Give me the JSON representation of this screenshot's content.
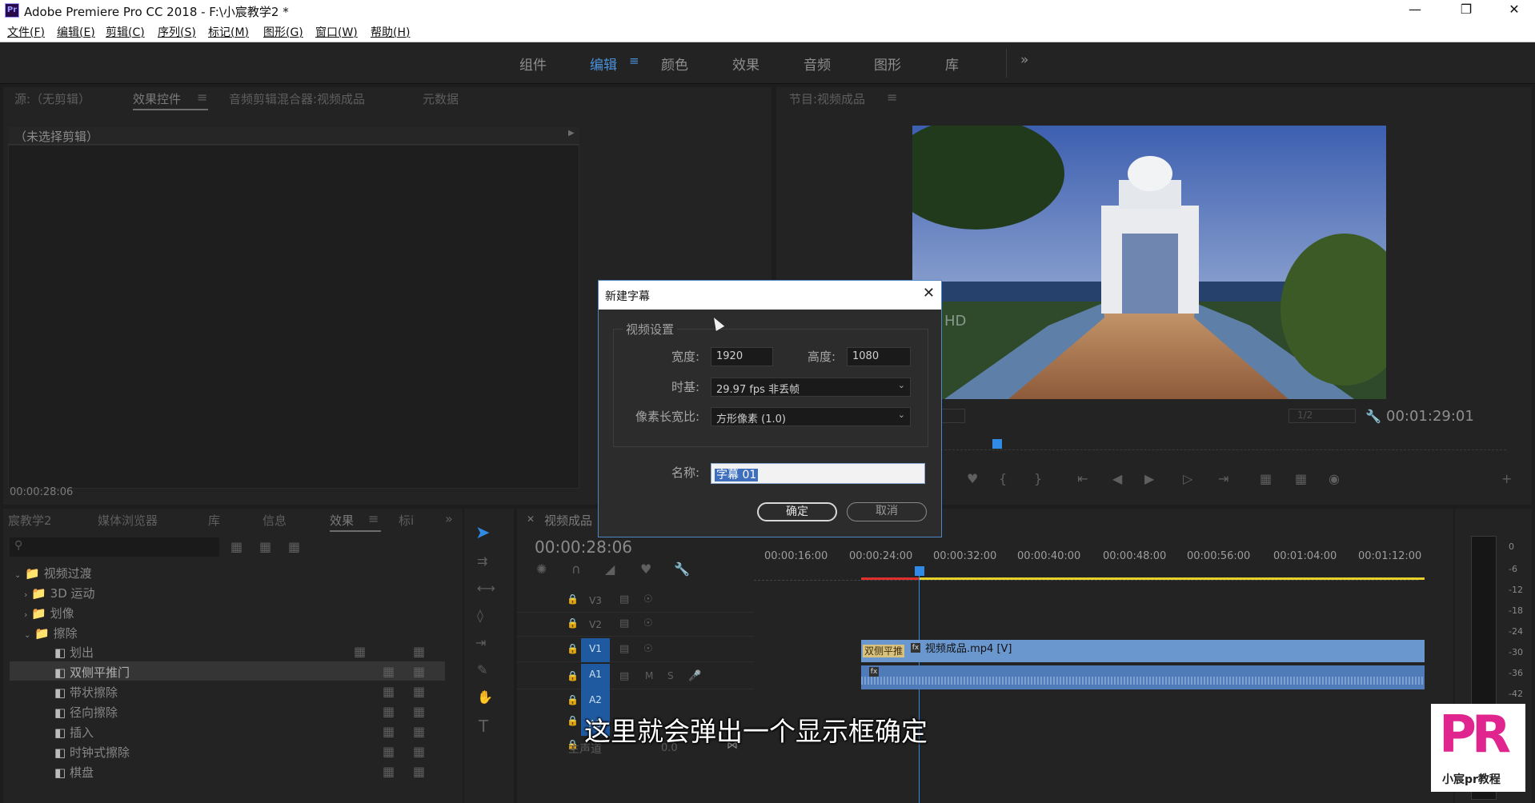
{
  "window": {
    "title": "Adobe Premiere Pro CC 2018 - F:\\小宸教学2 *",
    "logo": "Pr",
    "minimize_icon": "minimize-icon",
    "restore_icon": "restore-icon",
    "close_icon": "close-icon"
  },
  "menu": [
    "文件(F)",
    "编辑(E)",
    "剪辑(C)",
    "序列(S)",
    "标记(M)",
    "图形(G)",
    "窗口(W)",
    "帮助(H)"
  ],
  "workspaces": [
    "组件",
    "编辑",
    "颜色",
    "效果",
    "音频",
    "图形",
    "库"
  ],
  "workspace_active": "编辑",
  "source_panel": {
    "tabs": [
      "源:（无剪辑）",
      "效果控件",
      "音频剪辑混合器:视频成品",
      "元数据"
    ],
    "active_tab": "效果控件",
    "no_clip_label": "（未选择剪辑）",
    "timecode": "00:00:28:06"
  },
  "program_panel": {
    "tab": "节目:视频成品",
    "timecode": "00:01:29:01",
    "resolution": "1/2",
    "watermark": "HD"
  },
  "project_panel": {
    "tabs": [
      "宸教学2",
      "媒体浏览器",
      "库",
      "信息",
      "效果",
      "标i"
    ],
    "active_tab": "效果",
    "tree": [
      {
        "label": "视频过渡",
        "level": 0,
        "expanded": true
      },
      {
        "label": "3D 运动",
        "level": 1,
        "expanded": false
      },
      {
        "label": "划像",
        "level": 1,
        "expanded": false
      },
      {
        "label": "擦除",
        "level": 1,
        "expanded": true
      },
      {
        "label": "划出",
        "level": 2
      },
      {
        "label": "双侧平推门",
        "level": 2,
        "selected": true
      },
      {
        "label": "带状擦除",
        "level": 2
      },
      {
        "label": "径向擦除",
        "level": 2
      },
      {
        "label": "插入",
        "level": 2
      },
      {
        "label": "时钟式擦除",
        "level": 2
      },
      {
        "label": "棋盘",
        "level": 2
      }
    ]
  },
  "timeline": {
    "tab": "视频成品",
    "timecode": "00:00:28:06",
    "ruler": [
      "00:00:16:00",
      "00:00:24:00",
      "00:00:32:00",
      "00:00:40:00",
      "00:00:48:00",
      "00:00:56:00",
      "00:01:04:00",
      "00:01:12:00"
    ],
    "tracks": [
      "V3",
      "V2",
      "V1",
      "A1",
      "A2",
      "A3"
    ],
    "master_label": "主声道",
    "master_value": "0.0",
    "clip_label": "视频成品.mp4 [V]",
    "transition_label": "双侧平推",
    "fx_badge": "fx"
  },
  "meter_labels": [
    "0",
    "-6",
    "-12",
    "-18",
    "-24",
    "-30",
    "-36",
    "-42"
  ],
  "dialog": {
    "title": "新建字幕",
    "section": "视频设置",
    "width_label": "宽度:",
    "width_value": "1920",
    "height_label": "高度:",
    "height_value": "1080",
    "timebase_label": "时基:",
    "timebase_value": "29.97 fps 非丢帧",
    "par_label": "像素长宽比:",
    "par_value": "方形像素 (1.0)",
    "name_label": "名称:",
    "name_value": "字幕 01",
    "ok_label": "确定",
    "cancel_label": "取消"
  },
  "subtitle": "这里就会弹出一个显示框确定",
  "brand": {
    "logo_text": "PR",
    "caption": "小宸pr教程"
  },
  "colors": {
    "accent": "#4a90d9",
    "clip_video": "#6b97cf",
    "clip_audio": "#4f7cb8",
    "playhead": "#2f8be6"
  }
}
